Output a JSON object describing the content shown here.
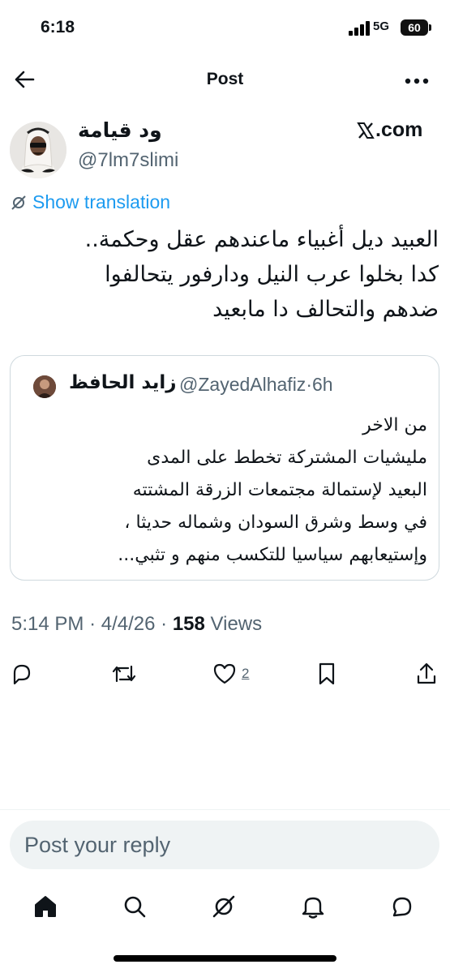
{
  "status_bar": {
    "time": "6:18",
    "network": "5G",
    "battery": "60"
  },
  "header": {
    "title": "Post",
    "back_icon": "arrow-left-icon",
    "more_icon": "more-horizontal-icon"
  },
  "post": {
    "author": {
      "display_name": "ود قيامة",
      "handle": "@7lm7slimi"
    },
    "source": ".com",
    "show_translation": "Show translation",
    "text_lines": [
      "العبيد ديل أغبياء ماعندهم عقل وحكمة..",
      "كدا بخلوا عرب النيل ودارفور يتحالفوا",
      "ضدهم والتحالف دا مابعيد"
    ],
    "quote": {
      "display_name": "زايد الحافظ",
      "handle": "@ZayedAlhafiz",
      "time": "6h",
      "text_lines": [
        "من الاخر",
        "مليشيات المشتركة تخطط على المدى",
        "البعيد لإستمالة مجتمعات الزرقة المشتته",
        "في وسط وشرق السودان وشماله حديثا ،",
        "وإستيعابهم سياسيا للتكسب منهم و تثبي..."
      ]
    },
    "timestamp": {
      "time": "5:14 PM",
      "date": "4/4/26",
      "views_count": "158",
      "views_label": "Views"
    },
    "actions": {
      "like_count": "2",
      "icons": [
        "reply-icon",
        "repost-icon",
        "like-icon",
        "bookmark-icon",
        "share-icon"
      ]
    }
  },
  "reply": {
    "placeholder": "Post your reply"
  },
  "bottom_nav": {
    "items": [
      "home-icon",
      "search-icon",
      "grok-icon",
      "notifications-icon",
      "messages-icon"
    ]
  },
  "colors": {
    "accent": "#1d9bf0",
    "text": "#0f1419",
    "secondary": "#536471",
    "border": "#cfd9de"
  }
}
